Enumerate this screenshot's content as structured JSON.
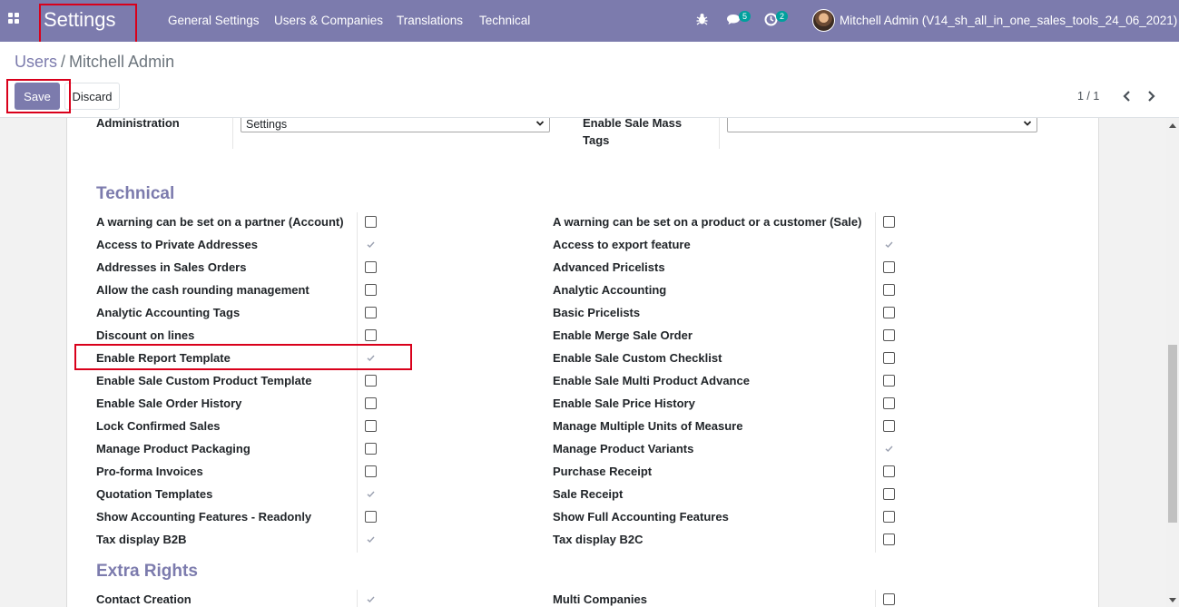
{
  "navbar": {
    "app_title": "Settings",
    "menu": [
      "General Settings",
      "Users & Companies",
      "Translations",
      "Technical"
    ],
    "messages_count": "5",
    "activities_count": "2",
    "user_name": "Mitchell Admin (V14_sh_all_in_one_sales_tools_24_06_2021)",
    "color": "#7c7bad"
  },
  "breadcrumb": {
    "parent": "Users",
    "separator": "/",
    "current": "Mitchell Admin"
  },
  "buttons": {
    "save": "Save",
    "discard": "Discard"
  },
  "pager": {
    "value": "1 / 1"
  },
  "top_fields": {
    "left_label": "Administration",
    "left_value": "Settings",
    "right_label_1": "Enable Sale Mass",
    "right_label_2": "Tags",
    "right_value": ""
  },
  "technical": {
    "title": "Technical",
    "left": [
      {
        "label": "A warning can be set on a partner (Account)",
        "checked": false
      },
      {
        "label": "Access to Private Addresses",
        "checked": true
      },
      {
        "label": "Addresses in Sales Orders",
        "checked": false
      },
      {
        "label": "Allow the cash rounding management",
        "checked": false
      },
      {
        "label": "Analytic Accounting Tags",
        "checked": false
      },
      {
        "label": "Discount on lines",
        "checked": false
      },
      {
        "label": "Enable Report Template",
        "checked": true
      },
      {
        "label": "Enable Sale Custom Product Template",
        "checked": false
      },
      {
        "label": "Enable Sale Order History",
        "checked": false
      },
      {
        "label": "Lock Confirmed Sales",
        "checked": false
      },
      {
        "label": "Manage Product Packaging",
        "checked": false
      },
      {
        "label": "Pro-forma Invoices",
        "checked": false
      },
      {
        "label": "Quotation Templates",
        "checked": true
      },
      {
        "label": "Show Accounting Features - Readonly",
        "checked": false
      },
      {
        "label": "Tax display B2B",
        "checked": true
      }
    ],
    "right": [
      {
        "label": "A warning can be set on a product or a customer (Sale)",
        "checked": false
      },
      {
        "label": "Access to export feature",
        "checked": true
      },
      {
        "label": "Advanced Pricelists",
        "checked": false
      },
      {
        "label": "Analytic Accounting",
        "checked": false
      },
      {
        "label": "Basic Pricelists",
        "checked": false
      },
      {
        "label": "Enable Merge Sale Order",
        "checked": false
      },
      {
        "label": "Enable Sale Custom Checklist",
        "checked": false
      },
      {
        "label": "Enable Sale Multi Product Advance",
        "checked": false
      },
      {
        "label": "Enable Sale Price History",
        "checked": false
      },
      {
        "label": "Manage Multiple Units of Measure",
        "checked": false
      },
      {
        "label": "Manage Product Variants",
        "checked": true
      },
      {
        "label": "Purchase Receipt",
        "checked": false
      },
      {
        "label": "Sale Receipt",
        "checked": false
      },
      {
        "label": "Show Full Accounting Features",
        "checked": false
      },
      {
        "label": "Tax display B2C",
        "checked": false
      }
    ]
  },
  "extra_rights": {
    "title": "Extra Rights",
    "left": [
      {
        "label": "Contact Creation",
        "checked": true
      }
    ],
    "right": [
      {
        "label": "Multi Companies",
        "checked": false
      }
    ]
  }
}
